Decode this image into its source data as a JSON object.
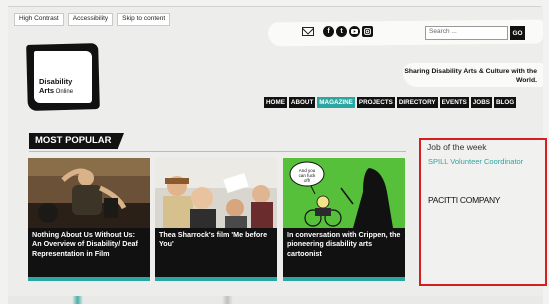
{
  "a11y_links": [
    "High Contrast",
    "Accessibility",
    "Skip to content"
  ],
  "social_icons": [
    "mail-icon",
    "facebook-icon",
    "twitter-icon",
    "youtube-icon",
    "instagram-icon"
  ],
  "search": {
    "placeholder": "Search ...",
    "button_label": "GO"
  },
  "logo": {
    "line1": "Disability",
    "line2_bold": "Arts",
    "line2_rest": " Online"
  },
  "tagline": "Sharing Disability Arts & Culture with the World.",
  "nav": {
    "items": [
      "HOME",
      "ABOUT",
      "MAGAZINE",
      "PROJECTS",
      "DIRECTORY",
      "EVENTS",
      "JOBS",
      "BLOG"
    ],
    "active": "MAGAZINE",
    "active_color": "#2aa7a0"
  },
  "most_popular": {
    "title": "MOST POPULAR",
    "cards": [
      {
        "caption": "Nothing About Us Without Us: An Overview of Disability/ Deaf Representation in Film"
      },
      {
        "caption": "Thea Sharrock's film 'Me before You'"
      },
      {
        "caption": "In conversation with Crippen, the pioneering disability arts cartoonist",
        "bubble": "And you can fuck off!"
      }
    ]
  },
  "job_of_week": {
    "title": "Job of the week",
    "link": "SPILL Volunteer Coordinator",
    "org": "PACITTI COMPANY",
    "border_color": "#d31f1f"
  },
  "colors": {
    "accent": "#2aa7a0",
    "dark": "#111111"
  }
}
